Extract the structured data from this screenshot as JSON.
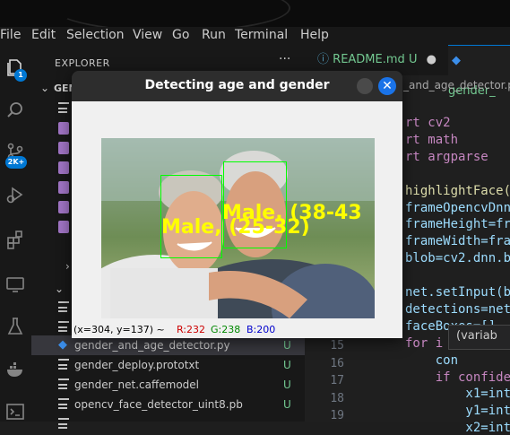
{
  "menu": [
    "File",
    "Edit",
    "Selection",
    "View",
    "Go",
    "Run",
    "Terminal",
    "Help"
  ],
  "activity": {
    "explorer_badge": "1",
    "source_control_badge": "2K+"
  },
  "explorer": {
    "title": "EXPLORER",
    "more": "···",
    "section": "GEN",
    "files": [
      {
        "name": "gender_and_age_detector.py",
        "status": "U",
        "selected": true
      },
      {
        "name": "gender_deploy.prototxt",
        "status": "U",
        "selected": false
      },
      {
        "name": "gender_net.caffemodel",
        "status": "U",
        "selected": false
      },
      {
        "name": "opencv_face_detector_uint8.pb",
        "status": "U",
        "selected": false
      }
    ]
  },
  "tabs": [
    {
      "label": "README.md",
      "status": "U",
      "active": false
    },
    {
      "label": "gender_",
      "active": true
    }
  ],
  "breadcrumb": "_and_age_detector.py",
  "code_lines": [
    {
      "text": "rt cv2",
      "color": "#c586c0"
    },
    {
      "text": "rt math",
      "color": "#c586c0"
    },
    {
      "text": "rt argparse",
      "color": "#c586c0"
    },
    {
      "text": "",
      "color": "#ccc"
    },
    {
      "text": "highlightFace(n",
      "color": "#dcdcaa"
    },
    {
      "text": "frameOpencvDnn=",
      "color": "#9cdcfe"
    },
    {
      "text": "frameHeight=fra",
      "color": "#9cdcfe"
    },
    {
      "text": "frameWidth=fram",
      "color": "#9cdcfe"
    },
    {
      "text": "blob=cv2.dnn.bl",
      "color": "#9cdcfe"
    },
    {
      "text": "",
      "color": "#ccc"
    },
    {
      "text": "net.setInput(bl",
      "color": "#9cdcfe"
    },
    {
      "text": "detections=net.",
      "color": "#9cdcfe"
    },
    {
      "text": "faceBoxes=[]",
      "color": "#9cdcfe"
    },
    {
      "text": "for i i",
      "color": "#c586c0"
    },
    {
      "text": "    con",
      "color": "#9cdcfe"
    },
    {
      "text": "    if confiden",
      "color": "#c586c0"
    },
    {
      "text": "        x1=int(",
      "color": "#9cdcfe"
    },
    {
      "text": "        y1=int(",
      "color": "#9cdcfe"
    },
    {
      "text": "        x2=int(",
      "color": "#9cdcfe"
    }
  ],
  "line_numbers": [
    "15",
    "16",
    "17",
    "18",
    "19"
  ],
  "hover_text": "(variab",
  "window": {
    "title": "Detecting age and gender",
    "close_symbol": "✕",
    "label_left": "Male, (25-32)",
    "label_right": "Male, (38-43",
    "status": {
      "coords": "(x=304, y=137) ~",
      "r": "R:232",
      "g": "G:238",
      "b": "B:200"
    }
  }
}
